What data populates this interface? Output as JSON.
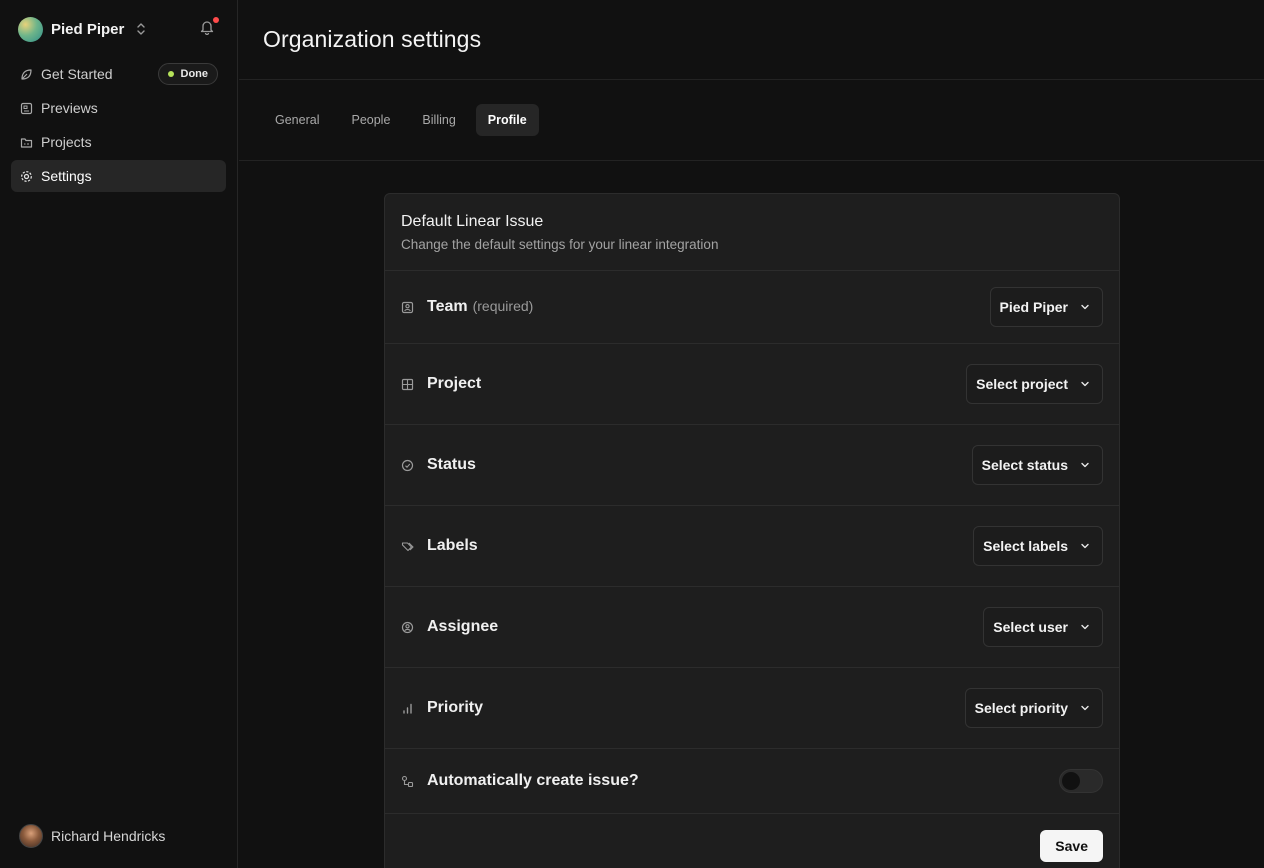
{
  "org": {
    "name": "Pied Piper"
  },
  "sidebar": {
    "items": [
      {
        "label": "Get Started",
        "icon": "leaf-icon",
        "badge": "Done"
      },
      {
        "label": "Previews",
        "icon": "previews-icon"
      },
      {
        "label": "Projects",
        "icon": "folder-icon"
      },
      {
        "label": "Settings",
        "icon": "gear-icon",
        "active": true
      }
    ]
  },
  "user": {
    "name": "Richard Hendricks"
  },
  "header": {
    "title": "Organization settings"
  },
  "tabs": [
    {
      "label": "General"
    },
    {
      "label": "People"
    },
    {
      "label": "Billing"
    },
    {
      "label": "Profile",
      "active": true
    }
  ],
  "card": {
    "title": "Default Linear Issue",
    "subtitle": "Change the default settings for your linear integration",
    "fields": [
      {
        "label": "Team",
        "hint": "(required)",
        "value": "Pied Piper",
        "icon": "team-icon"
      },
      {
        "label": "Project",
        "value": "Select project",
        "icon": "grid-icon"
      },
      {
        "label": "Status",
        "value": "Select status",
        "icon": "status-icon"
      },
      {
        "label": "Labels",
        "value": "Select labels",
        "icon": "tag-icon"
      },
      {
        "label": "Assignee",
        "value": "Select user",
        "icon": "user-circle-icon"
      },
      {
        "label": "Priority",
        "value": "Select priority",
        "icon": "priority-bars-icon"
      }
    ],
    "auto_create": {
      "label": "Automatically create issue?",
      "enabled": false,
      "icon": "link-icon"
    },
    "save_label": "Save"
  },
  "colors": {
    "accent_dot": "#b6e35a",
    "notification": "#ff4b4b",
    "background": "#111111",
    "card": "#1e1e1e"
  }
}
